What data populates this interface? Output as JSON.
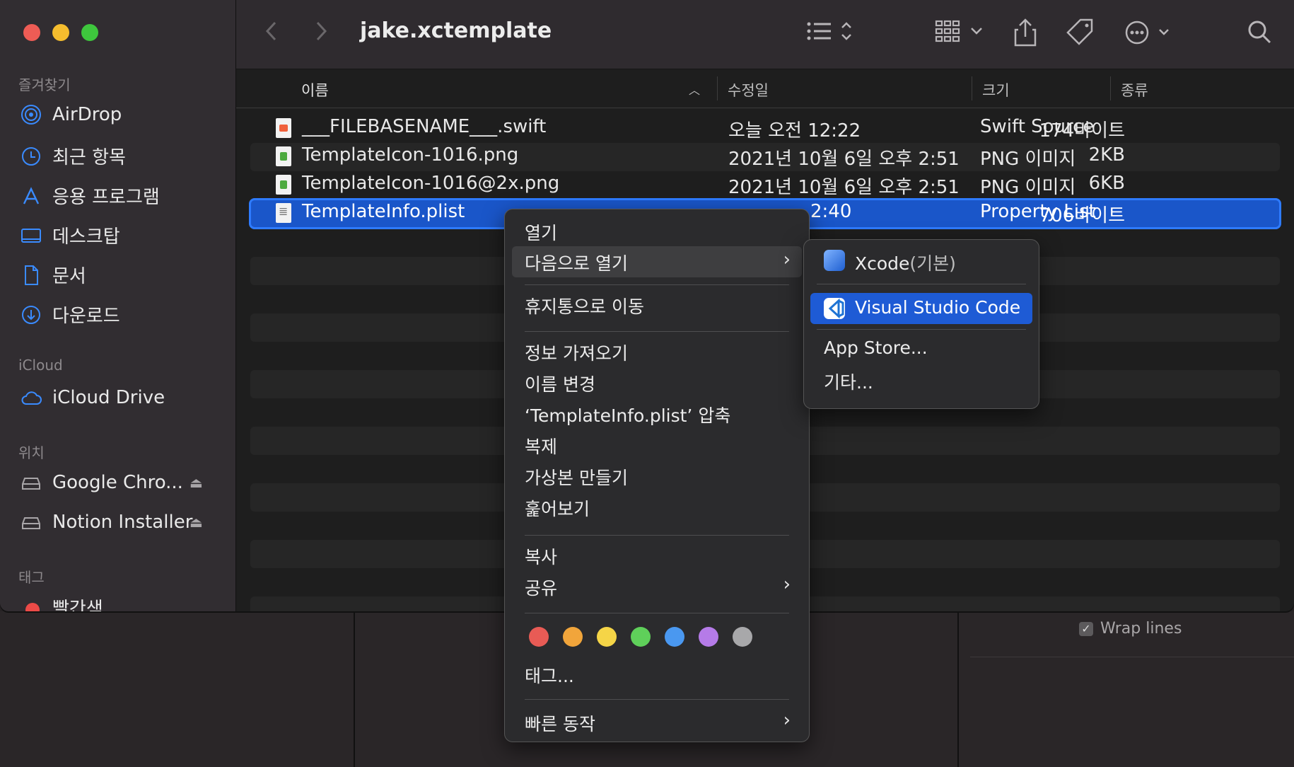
{
  "window": {
    "title": "jake.xctemplate"
  },
  "sidebar": {
    "favorites_header": "즐겨찾기",
    "favorites": [
      {
        "label": "AirDrop",
        "icon": "airdrop-icon"
      },
      {
        "label": "최근 항목",
        "icon": "clock-icon"
      },
      {
        "label": "응용 프로그램",
        "icon": "applications-icon"
      },
      {
        "label": "데스크탑",
        "icon": "desktop-icon"
      },
      {
        "label": "문서",
        "icon": "document-icon"
      },
      {
        "label": "다운로드",
        "icon": "download-icon"
      }
    ],
    "icloud_header": "iCloud",
    "icloud": [
      {
        "label": "iCloud Drive",
        "icon": "cloud-icon"
      }
    ],
    "locations_header": "위치",
    "locations": [
      {
        "label": "Google Chro...",
        "icon": "disk-icon"
      },
      {
        "label": "Notion Installer",
        "icon": "disk-icon"
      }
    ],
    "tags_header": "태그",
    "tags": [
      {
        "label": "빨간색",
        "color": "#ec4a47"
      }
    ]
  },
  "columns": {
    "name": "이름",
    "modified": "수정일",
    "size": "크기",
    "kind": "종류"
  },
  "files": [
    {
      "name": "___FILEBASENAME___.swift",
      "modified": "오늘 오전 12:22",
      "size": "174바이트",
      "kind": "Swift Source",
      "icon": "swift-file-icon"
    },
    {
      "name": "TemplateIcon-1016.png",
      "modified": "2021년 10월 6일 오후 2:51",
      "size": "2KB",
      "kind": "PNG 이미지",
      "icon": "png-file-icon"
    },
    {
      "name": "TemplateIcon-1016@2x.png",
      "modified": "2021년 10월 6일 오후 2:51",
      "size": "6KB",
      "kind": "PNG 이미지",
      "icon": "png-file-icon"
    },
    {
      "name": "TemplateInfo.plist",
      "modified": "2:40",
      "size": "706바이트",
      "kind": "Property List",
      "icon": "plist-file-icon"
    }
  ],
  "context_menu": {
    "open": "열기",
    "open_with": "다음으로 열기",
    "move_to_trash": "휴지통으로 이동",
    "get_info": "정보 가져오기",
    "rename": "이름 변경",
    "compress": "‘TemplateInfo.plist’ 압축",
    "duplicate": "복제",
    "make_alias": "가상본 만들기",
    "quick_look": "훑어보기",
    "copy": "복사",
    "share": "공유",
    "tags_label": "태그...",
    "quick_actions": "빠른 동작",
    "tag_colors": [
      "#e85b55",
      "#f1a53b",
      "#f5d547",
      "#5fd05a",
      "#4a98f0",
      "#b57be8",
      "#a8a8aa"
    ]
  },
  "submenu": {
    "xcode": "Xcode",
    "xcode_suffix": "(기본)",
    "vscode": "Visual Studio Code",
    "app_store": "App Store...",
    "other": "기타..."
  },
  "background": {
    "wrap_lines": "Wrap lines"
  }
}
